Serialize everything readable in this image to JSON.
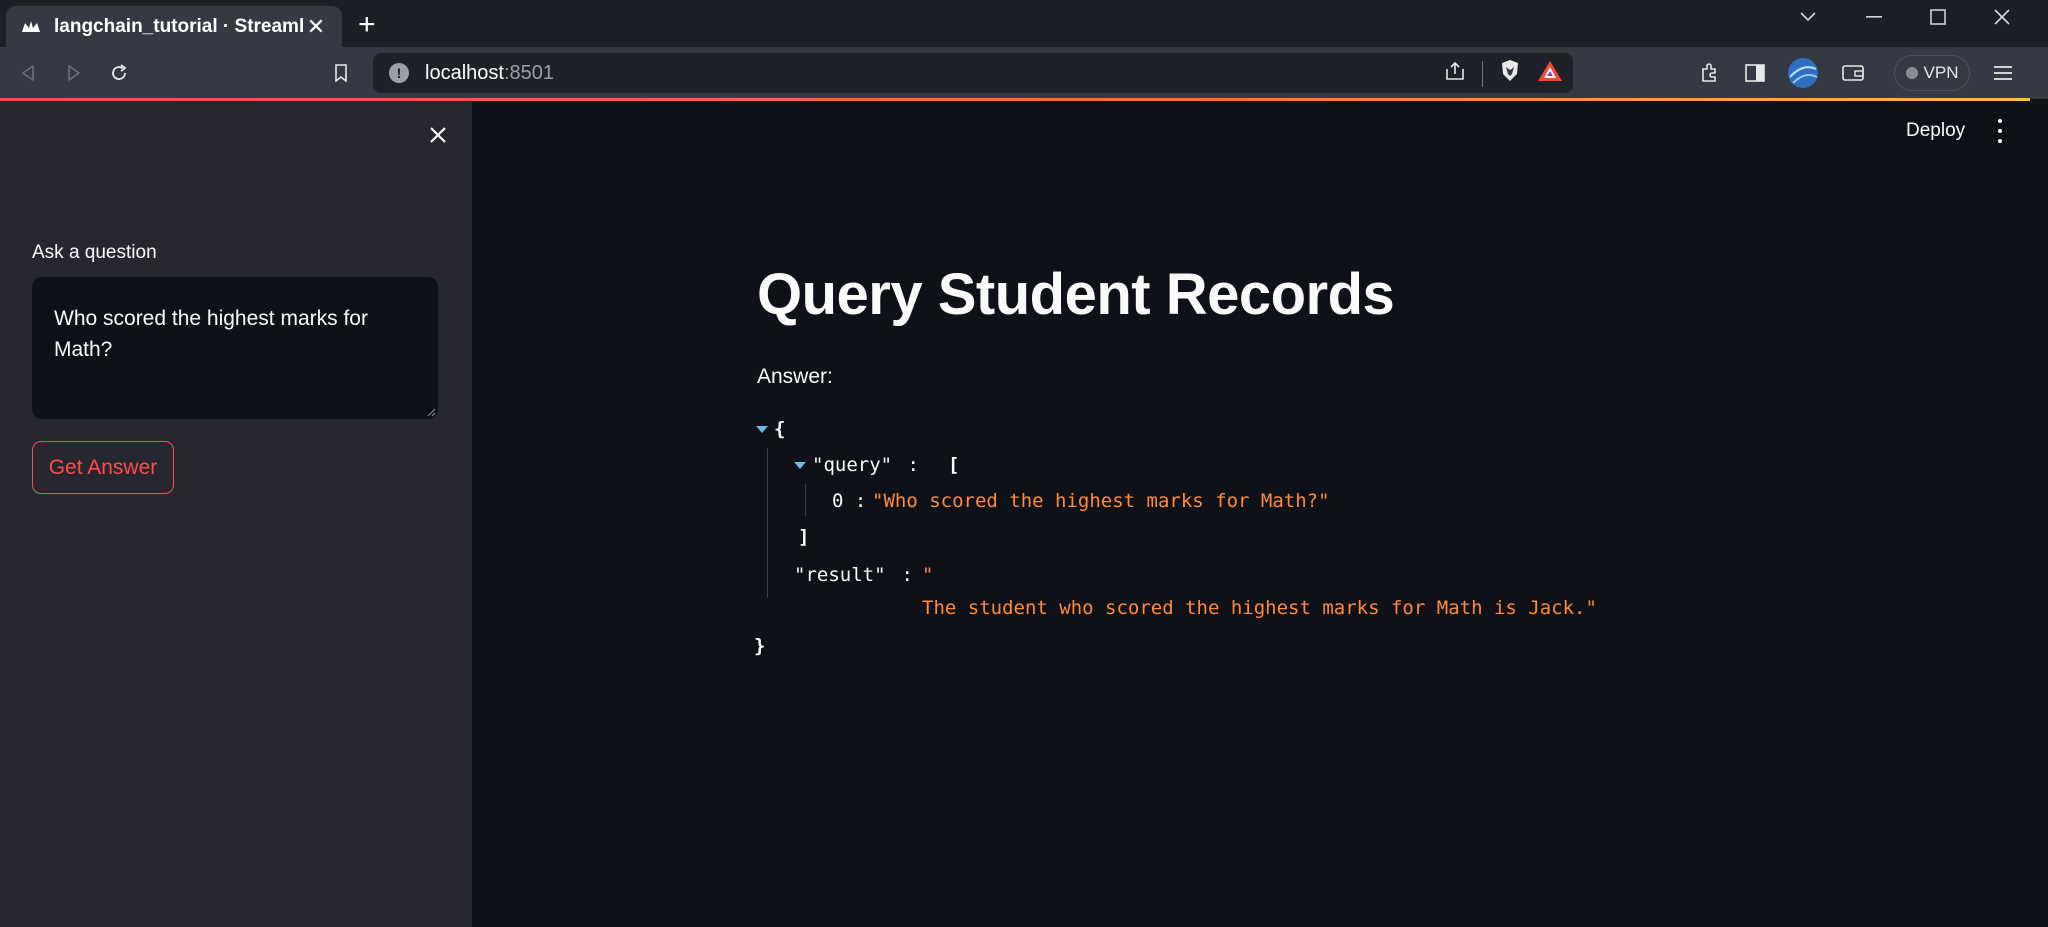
{
  "browser": {
    "tab_title": "langchain_tutorial · Streamlit",
    "tab_close": "✕",
    "new_tab": "+",
    "url_host": "localhost",
    "url_port": ":8501",
    "vpn_label": "VPN"
  },
  "sidebar": {
    "field_label": "Ask a question",
    "question_value": "Who scored the highest marks for Math?",
    "button_label": "Get Answer"
  },
  "header": {
    "deploy_label": "Deploy"
  },
  "main": {
    "title": "Query Student Records",
    "answer_label": "Answer:"
  },
  "json_view": {
    "open_brace": "{",
    "close_brace": "}",
    "query_key": "\"query\"",
    "colon": " : ",
    "open_bracket": "[",
    "close_bracket": "]",
    "index_0": "0 :",
    "query_value": "\"Who scored the highest marks for Math?\"",
    "result_key": "\"result\"",
    "result_open_quote": "\"",
    "result_value": "The student who scored the highest marks for Math is Jack.\""
  },
  "colors": {
    "accent": "#ff4b4b",
    "string": "#ff8a3d",
    "caret": "#6fb8e8",
    "sidebar_bg": "#262730",
    "main_bg": "#0e1117"
  },
  "icons": [
    "streamlit-favicon",
    "back-icon",
    "forward-icon",
    "reload-icon",
    "bookmark-icon",
    "info-icon",
    "share-icon",
    "brave-shield-icon",
    "brave-rewards-icon",
    "extensions-icon",
    "sidebar-icon",
    "profile-icon",
    "wallet-icon",
    "menu-icon",
    "close-icon",
    "kebab-icon"
  ]
}
